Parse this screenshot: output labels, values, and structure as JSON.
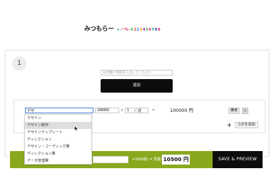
{
  "header": {
    "logo_text": "みつもらー",
    "logo_chars": [
      {
        "ch": "+",
        "color": "#2a9d8f"
      },
      {
        "ch": "-",
        "color": "#2a6fd6"
      },
      {
        "ch": "*",
        "color": "#e07a2a"
      },
      {
        "ch": "%",
        "color": "#c2185b"
      },
      {
        "ch": "-",
        "color": "#888888"
      },
      {
        "ch": "0",
        "color": "#4caf50"
      },
      {
        "ch": "1",
        "color": "#e53935"
      },
      {
        "ch": "2",
        "color": "#1e88e5"
      },
      {
        "ch": "3",
        "color": "#fb8c00"
      },
      {
        "ch": "4",
        "color": "#8e24aa"
      },
      {
        "ch": "5",
        "color": "#43a047"
      },
      {
        "ch": "6",
        "color": "#e91e63"
      },
      {
        "ch": "7",
        "color": "#00897b"
      },
      {
        "ch": "8",
        "color": "#3949ab"
      },
      {
        "ch": "9",
        "color": "#d81b60"
      }
    ]
  },
  "section": {
    "number": "1",
    "item_placeholder": "お見積り項目を入力してください",
    "add_label": "追加"
  },
  "line_item": {
    "name_value": "デザ",
    "price_value": "100000",
    "times_symbol": "×",
    "qty_value": "1",
    "unit_value": "式",
    "equals_symbol": "=",
    "subtotal": "100000 円",
    "memo_label": "備考",
    "delete_symbol": "×",
    "add_subitem_label": "小計を追加",
    "plus_symbol": "+"
  },
  "suggestions": [
    "デザイン",
    "デザイン制作",
    "デザインテンプレート",
    "ディレクション",
    "デザイン・コーディング費",
    "ディレクション費",
    "データ管理費"
  ],
  "suggestion_selected_index": 1,
  "footer": {
    "formula_text": "+500(税) = 見積り",
    "grand_total": "10500 円",
    "save_label": "SAVE & PREVIEW"
  },
  "colors": {
    "accent_bar": "#8aa81e",
    "button_dark": "#0d0d0d"
  }
}
